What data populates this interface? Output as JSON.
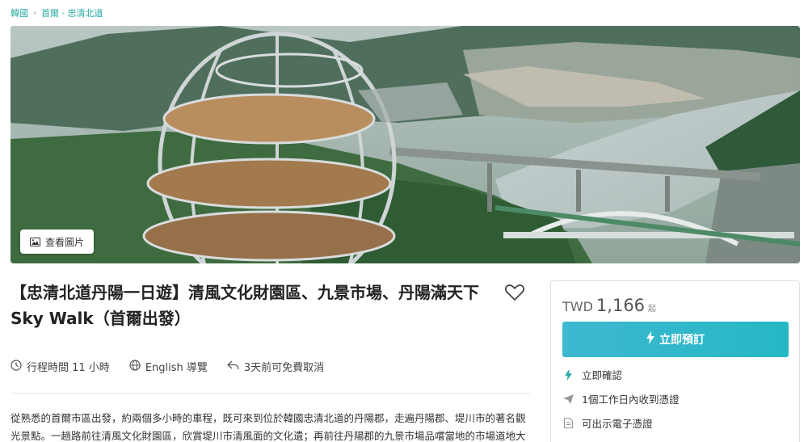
{
  "breadcrumb": {
    "items": [
      "韓國",
      "首爾 · 忠清北道"
    ],
    "separator": "›"
  },
  "hero": {
    "view_photos_label": "查看圖片"
  },
  "title": "【忠清北道丹陽一日遊】清風文化財園區、九景市場、丹陽滿天下 Sky Walk（首爾出發）",
  "meta": {
    "duration": "行程時間 11 小時",
    "language": "English 導覽",
    "cancellation": "3天前可免費取消"
  },
  "description": "從熟悉的首爾市區出發，約兩個多小時的車程，既可來到位於韓國忠清北道的丹陽郡，走遍丹陽郡、堤川市的著名觀光景點。一趟路前往清風文化財園區，欣賞堤川市清風面的文化遺；再前往丹陽郡的九景市場品嚐當地的市場道地大",
  "booking": {
    "currency": "TWD",
    "price": "1,166",
    "price_suffix": "起",
    "book_label": "立即預訂",
    "features": [
      "立即確認",
      "1個工作日內收到憑證",
      "可出示電子憑證"
    ]
  },
  "colors": {
    "accent": "#26a9a3",
    "button": "#2bb5c8"
  }
}
